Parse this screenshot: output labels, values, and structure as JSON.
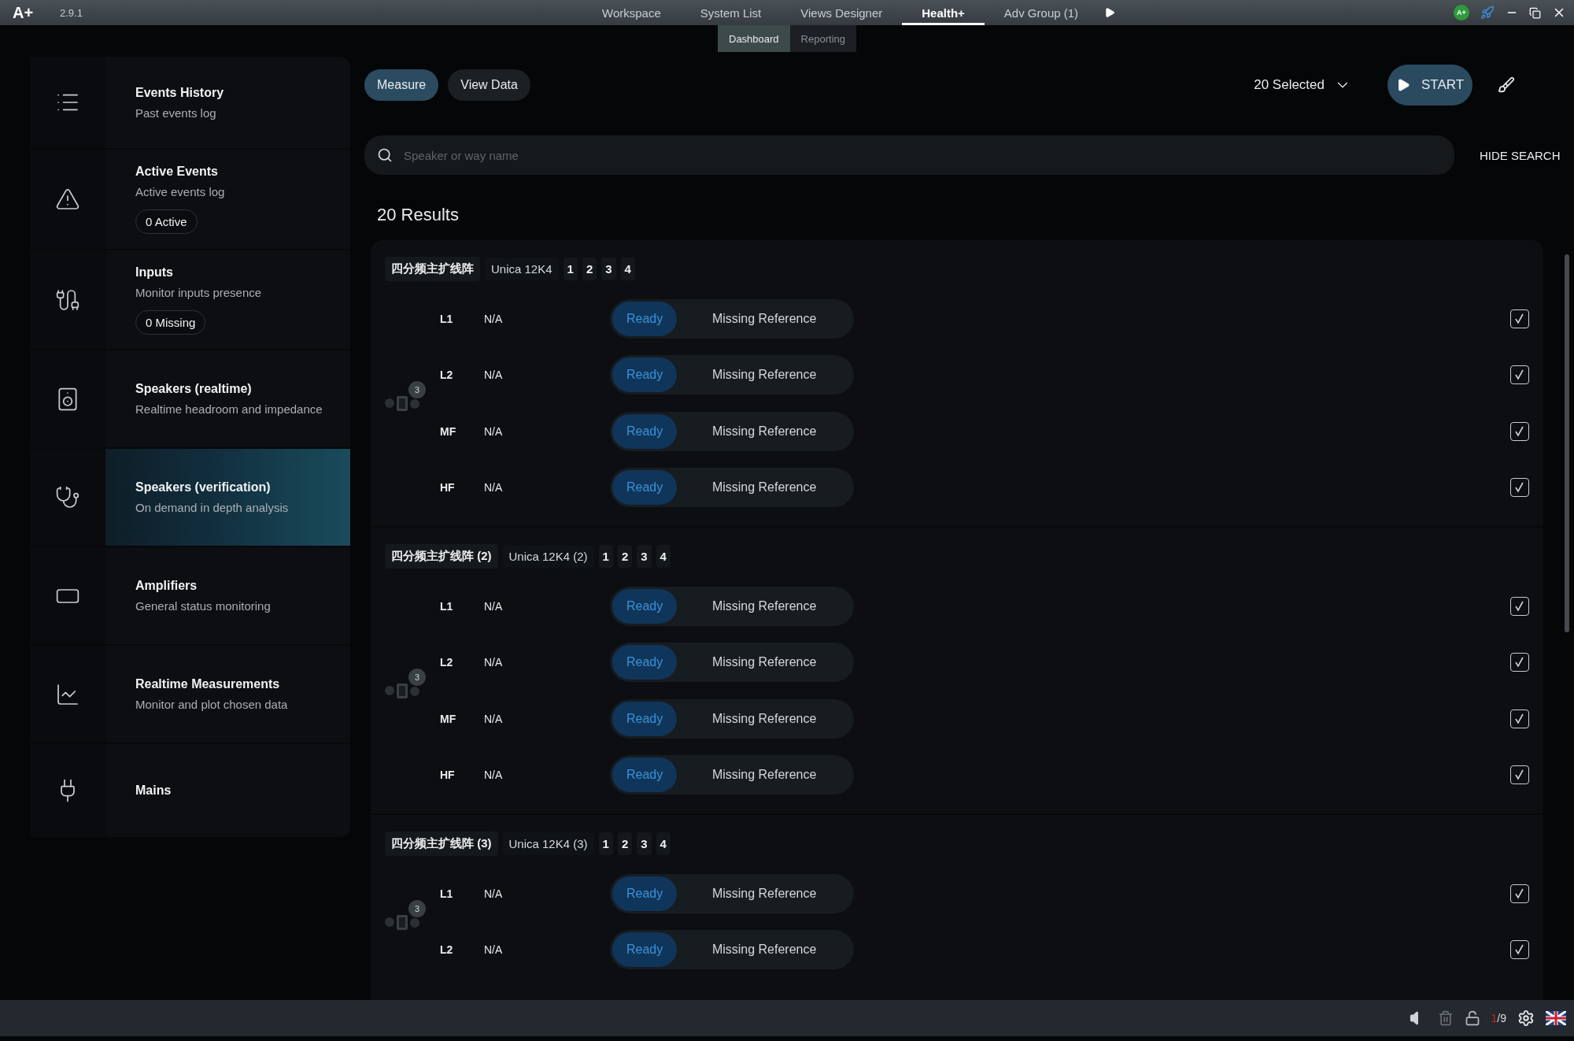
{
  "app": {
    "logo": "A+",
    "version": "2.9.1"
  },
  "top_tabs": [
    {
      "label": "Workspace",
      "selected": false
    },
    {
      "label": "System List",
      "selected": false
    },
    {
      "label": "Views Designer",
      "selected": false
    },
    {
      "label": "Health+",
      "selected": true
    },
    {
      "label": "Adv Group (1)",
      "selected": false
    }
  ],
  "window_controls": {
    "badge": "A+"
  },
  "sub_tabs": [
    {
      "label": "Dashboard",
      "selected": true
    },
    {
      "label": "Reporting",
      "selected": false
    }
  ],
  "sidebar": {
    "items": [
      {
        "title": "Events History",
        "subtitle": "Past events log",
        "selected": false
      },
      {
        "title": "Active Events",
        "subtitle": "Active events log",
        "count": "0 Active",
        "selected": false
      },
      {
        "title": "Inputs",
        "subtitle": "Monitor inputs presence",
        "count": "0 Missing",
        "selected": false
      },
      {
        "title": "Speakers (realtime)",
        "subtitle": "Realtime headroom and impedance",
        "selected": false
      },
      {
        "title": "Speakers (verification)",
        "subtitle": "On demand in depth analysis",
        "selected": true
      },
      {
        "title": "Amplifiers",
        "subtitle": "General status monitoring",
        "selected": false
      },
      {
        "title": "Realtime Measurements",
        "subtitle": "Monitor and plot chosen data",
        "selected": false
      },
      {
        "title": "Mains",
        "selected": false
      }
    ]
  },
  "mode_tabs": [
    {
      "label": "Measure",
      "selected": true
    },
    {
      "label": "View Data",
      "selected": false
    }
  ],
  "selection": "20 Selected",
  "start_button": "START",
  "search": {
    "placeholder": "Speaker or way name",
    "hide_label": "HIDE SEARCH"
  },
  "results_title": "20 Results",
  "groups": [
    {
      "name": "四分频主扩线阵",
      "model": "Unica 12K4",
      "channels": [
        "1",
        "2",
        "3",
        "4"
      ],
      "badge": "3",
      "rows": [
        {
          "label": "L1",
          "value": "N/A",
          "status": [
            {
              "label": "Ready",
              "selected": true
            },
            {
              "label": "Missing Reference",
              "selected": false
            }
          ],
          "checked": true
        },
        {
          "label": "L2",
          "value": "N/A",
          "status": [
            {
              "label": "Ready",
              "selected": true
            },
            {
              "label": "Missing Reference",
              "selected": false
            }
          ],
          "checked": true
        },
        {
          "label": "MF",
          "value": "N/A",
          "status": [
            {
              "label": "Ready",
              "selected": true
            },
            {
              "label": "Missing Reference",
              "selected": false
            }
          ],
          "checked": true
        },
        {
          "label": "HF",
          "value": "N/A",
          "status": [
            {
              "label": "Ready",
              "selected": true
            },
            {
              "label": "Missing Reference",
              "selected": false
            }
          ],
          "checked": true
        }
      ]
    },
    {
      "name": "四分频主扩线阵 (2)",
      "model": "Unica 12K4 (2)",
      "channels": [
        "1",
        "2",
        "3",
        "4"
      ],
      "badge": "3",
      "rows": [
        {
          "label": "L1",
          "value": "N/A",
          "status": [
            {
              "label": "Ready",
              "selected": true
            },
            {
              "label": "Missing Reference",
              "selected": false
            }
          ],
          "checked": true
        },
        {
          "label": "L2",
          "value": "N/A",
          "status": [
            {
              "label": "Ready",
              "selected": true
            },
            {
              "label": "Missing Reference",
              "selected": false
            }
          ],
          "checked": true
        },
        {
          "label": "MF",
          "value": "N/A",
          "status": [
            {
              "label": "Ready",
              "selected": true
            },
            {
              "label": "Missing Reference",
              "selected": false
            }
          ],
          "checked": true
        },
        {
          "label": "HF",
          "value": "N/A",
          "status": [
            {
              "label": "Ready",
              "selected": true
            },
            {
              "label": "Missing Reference",
              "selected": false
            }
          ],
          "checked": true
        }
      ]
    },
    {
      "name": "四分频主扩线阵 (3)",
      "model": "Unica 12K4 (3)",
      "channels": [
        "1",
        "2",
        "3",
        "4"
      ],
      "badge": "3",
      "rows": [
        {
          "label": "L1",
          "value": "N/A",
          "status": [
            {
              "label": "Ready",
              "selected": true
            },
            {
              "label": "Missing Reference",
              "selected": false
            }
          ],
          "checked": true
        },
        {
          "label": "L2",
          "value": "N/A",
          "status": [
            {
              "label": "Ready",
              "selected": true
            },
            {
              "label": "Missing Reference",
              "selected": false
            }
          ],
          "checked": true
        }
      ]
    }
  ],
  "status_bar": {
    "counter_current": "1",
    "counter_total": "/9"
  }
}
